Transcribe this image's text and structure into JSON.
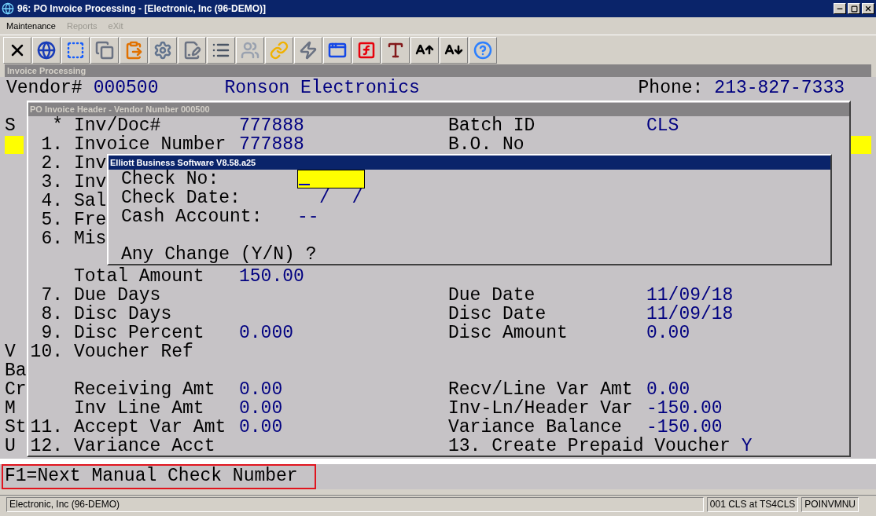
{
  "window": {
    "title": "96: PO Invoice Processing - [Electronic, Inc (96-DEMO)]"
  },
  "menu": [
    {
      "label": "Maintenance",
      "disabled": false
    },
    {
      "label": "Reports",
      "disabled": true
    },
    {
      "label": "eXit",
      "disabled": true
    }
  ],
  "panel_title": "Invoice Processing",
  "vendor": {
    "label": "Vendor#",
    "number": "000500",
    "name": "Ronson Electronics",
    "phone_label": "Phone:",
    "phone": "213-827-7333"
  },
  "background_labels": {
    "top": [
      "S"
    ],
    "bottom": [
      "V",
      "Ba",
      "Cr",
      "M",
      "St",
      "U"
    ]
  },
  "header_window": {
    "title": "PO Invoice Header - Vendor Number 000500",
    "rows": [
      {
        "kind": "field",
        "num": "*",
        "label": "Inv/Doc#",
        "value": "777888",
        "right_label": "Batch ID",
        "right_value": "CLS"
      },
      {
        "kind": "field",
        "num": "1.",
        "label": "Invoice Number",
        "value": "777888",
        "right_label": "B.O. No"
      },
      {
        "kind": "field",
        "num": "2.",
        "label": "Inv"
      },
      {
        "kind": "field",
        "num": "3.",
        "label": "Inv"
      },
      {
        "kind": "field",
        "num": "4.",
        "label": "Sal"
      },
      {
        "kind": "field",
        "num": "5.",
        "label": "Fre"
      },
      {
        "kind": "field",
        "num": "6.",
        "label": "Mis"
      },
      {
        "kind": "blank"
      },
      {
        "kind": "field",
        "label": "Total Amount",
        "value": "150.00"
      },
      {
        "kind": "field",
        "num": "7.",
        "label": "Due Days",
        "right_label": "Due Date",
        "right_value": "11/09/18"
      },
      {
        "kind": "field",
        "num": "8.",
        "label": "Disc Days",
        "right_label": "Disc Date",
        "right_value": "11/09/18"
      },
      {
        "kind": "field",
        "num": "9.",
        "label": "Disc Percent",
        "value": "0.000",
        "right_label": "Disc Amount",
        "right_value": "0.00"
      },
      {
        "kind": "field",
        "num": "10.",
        "label": "Voucher Ref"
      },
      {
        "kind": "blank"
      },
      {
        "kind": "field",
        "label": "Receiving Amt",
        "value": "0.00",
        "right_label": "Recv/Line Var Amt",
        "right_value": "0.00"
      },
      {
        "kind": "field",
        "label": "Inv Line Amt",
        "value": "0.00",
        "right_label": "Inv-Ln/Header Var",
        "right_value": "-150.00"
      },
      {
        "kind": "field",
        "num": "11.",
        "label": "Accept Var Amt",
        "value": "0.00",
        "right_label": "Variance Balance",
        "right_value": "-150.00"
      },
      {
        "kind": "field",
        "num": "12.",
        "label": "Variance Acct",
        "right_label": "13. Create Prepaid Voucher",
        "right_value": "Y"
      }
    ]
  },
  "dialog": {
    "title": "Elliott Business Software V8.58.a25",
    "fields": [
      {
        "kind": "input",
        "label": "Check No:"
      },
      {
        "kind": "date",
        "label": "Check Date:",
        "value": "/  /"
      },
      {
        "kind": "text",
        "label": "Cash Account:",
        "value": "--"
      }
    ],
    "prompt": "Any Change (Y/N) ?"
  },
  "message": "F1=Next Manual Check Number",
  "status_bar": [
    "Electronic, Inc (96-DEMO)",
    "001 CLS at TS4CLS",
    "POINVMNU"
  ]
}
